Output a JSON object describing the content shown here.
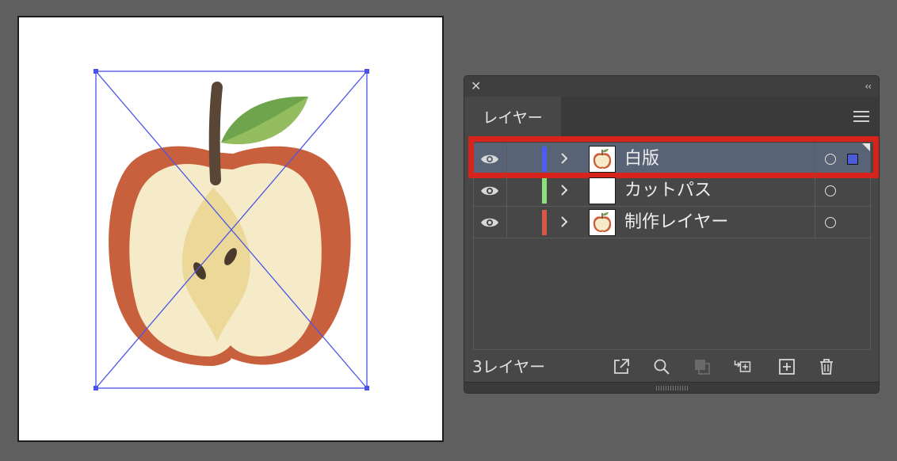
{
  "panel": {
    "tab_label": "レイヤー",
    "close_symbol": "✕",
    "collapse_symbol": "‹‹",
    "layer_count": "3レイヤー"
  },
  "layers": [
    {
      "name": "白版",
      "color": "#4d5df2",
      "selected": true,
      "thumb": "apple"
    },
    {
      "name": "カットパス",
      "color": "#8ce07a",
      "selected": false,
      "thumb": "blank"
    },
    {
      "name": "制作レイヤー",
      "color": "#d9574a",
      "selected": false,
      "thumb": "apple"
    }
  ],
  "footer_icons": [
    "export-icon",
    "search-icon",
    "clipping-mask-icon",
    "move-to-new-layer-icon",
    "new-layer-icon",
    "trash-icon"
  ],
  "colors": {
    "highlight": "#d6231c",
    "selection_bounds": "#4a55e6",
    "apple_skin": "#c9603d",
    "apple_flesh": "#f6ebc8",
    "apple_core": "#ecd99a",
    "leaf": "#6ea54c",
    "stem": "#5a4636"
  }
}
